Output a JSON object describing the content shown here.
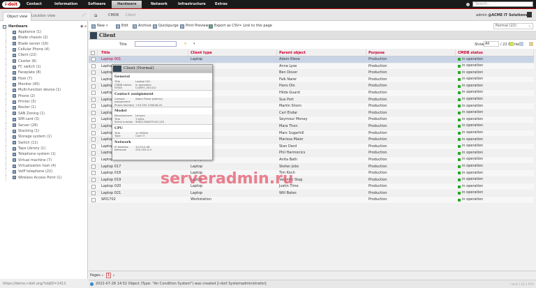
{
  "brand": {
    "logo": "i-doit",
    "accent": "#cc0000"
  },
  "nav": [
    "Contact",
    "Information",
    "Software",
    "Hardware",
    "Network",
    "Infrastructure",
    "Extras"
  ],
  "nav_active": "Hardware",
  "search": {
    "placeholder": "Search..."
  },
  "user": {
    "name": "admin",
    "tenant": "@ACME IT Solutions"
  },
  "sidebar": {
    "tabs": [
      "Object view",
      "Location view"
    ],
    "root": "Hardware",
    "items": [
      "Appliance (1)",
      "Blade chassis (2)",
      "Blade server (16)",
      "Cellular Phone (4)",
      "Client (22)",
      "Cluster (6)",
      "FC switch (1)",
      "Faceplate (8)",
      "Host (7)",
      "Monitor (45)",
      "Multi-function device (1)",
      "Phone (2)",
      "Printer (3)",
      "Router (1)",
      "SAN Zoning (1)",
      "SIM card (3)",
      "Server (26)",
      "Stacking (1)",
      "Storage system (1)",
      "Switch (11)",
      "Tape Library (1)",
      "Telephone system (1)",
      "Virtual machine (7)",
      "Virtualization host (4)",
      "VoIP telephone (22)",
      "Wireless Access Point (1)"
    ]
  },
  "breadcrumb": [
    "CMDB",
    "Client"
  ],
  "toolbar": {
    "new": "New",
    "edit": "Edit",
    "archive": "Archive",
    "quickpurge": "Quickpurge",
    "print": "Print Preview",
    "export": "Export as CSV",
    "link": "Link to this page"
  },
  "view_select": "Normal (22)",
  "page_title": "Client",
  "filter": {
    "label": "Title",
    "value": ""
  },
  "list_info": {
    "show_label": "Show",
    "show_value": "All",
    "entries": "/ 22 Entries"
  },
  "table": {
    "columns": [
      "Title",
      "Client type",
      "Parent object",
      "Purpose",
      "CMDB status"
    ],
    "rows": [
      [
        "Laptop 001",
        "Laptop",
        "Adam Riese",
        "Production",
        "in operation"
      ],
      [
        "Laptop 002",
        "Laptop",
        "Anna Lyse",
        "Production",
        "in operation"
      ],
      [
        "Laptop 003",
        "Laptop",
        "Ben Dover",
        "Production",
        "in operation"
      ],
      [
        "Laptop 004",
        "Laptop",
        "Falk Narer",
        "Production",
        "in operation"
      ],
      [
        "Laptop 005",
        "Laptop",
        "Hans Olo",
        "Production",
        "in operation"
      ],
      [
        "Laptop 006",
        "Laptop",
        "Hilde Guard",
        "Production",
        "in operation"
      ],
      [
        "Laptop 007",
        "Laptop",
        "Sue Port",
        "Production",
        "in operation"
      ],
      [
        "Laptop 008",
        "Laptop",
        "Martin Shorn",
        "Production",
        "in operation"
      ],
      [
        "Laptop 009",
        "Laptop",
        "Carl Endar",
        "Production",
        "in operation"
      ],
      [
        "Laptop 010",
        "Laptop",
        "Seymour Money",
        "Production",
        "in operation"
      ],
      [
        "Laptop 011",
        "Laptop",
        "Mara Thon",
        "Production",
        "in operation"
      ],
      [
        "Laptop 012",
        "Laptop",
        "Marc Sugarhill",
        "Production",
        "in operation"
      ],
      [
        "Laptop 013",
        "Laptop",
        "Marissa Maier",
        "Production",
        "in operation"
      ],
      [
        "Laptop 014",
        "Laptop",
        "Stan Dard",
        "Production",
        "in operation"
      ],
      [
        "Laptop 015",
        "Laptop",
        "Phil Harmonics",
        "Production",
        "in operation"
      ],
      [
        "Laptop 016",
        "Laptop",
        "Anita Bath",
        "Production",
        "in operation"
      ],
      [
        "Laptop 017",
        "Laptop",
        "Stefan Jobs",
        "Production",
        "in operation"
      ],
      [
        "Laptop 018",
        "Laptop",
        "Tim Koch",
        "Production",
        "in operation"
      ],
      [
        "Laptop 019",
        "Laptop",
        "Valentin Stag",
        "Production",
        "in operation"
      ],
      [
        "Laptop 020",
        "Laptop",
        "Justin Time",
        "Production",
        "in operation"
      ],
      [
        "Laptop 021",
        "Laptop",
        "Will Bates",
        "Production",
        "in operation"
      ],
      [
        "W01702",
        "Workstation",
        "",
        "Production",
        "in operation"
      ]
    ],
    "status_color": "#22aa22"
  },
  "popup": {
    "title": "Client (Normal)",
    "sections": [
      {
        "name": "General",
        "rows": [
          [
            "Title",
            "Laptop 001"
          ],
          [
            "CMDB status",
            "in operation"
          ],
          [
            "SYSID",
            "CLIENT_001412"
          ]
        ]
      },
      {
        "name": "Contact assignment",
        "rows": [
          [
            "Contact assignment",
            "Adam Riese [admin]"
          ],
          [
            "Phone Number",
            "+49 555 226048-20"
          ]
        ]
      },
      {
        "name": "Model",
        "rows": [
          [
            "Manufacturer",
            "Lenovo"
          ],
          [
            "Title",
            "T-450s"
          ],
          [
            "Serial number",
            "9082136487543112S"
          ]
        ]
      },
      {
        "name": "CPU",
        "rows": [
          [
            "Title",
            "1x 5600U"
          ],
          [
            "Type",
            "Core i7"
          ]
        ]
      },
      {
        "name": "Network",
        "rows": [
          [
            "IP Address",
            "10.20.0.46"
          ],
          [
            "Netmask",
            "255.255.0.0"
          ]
        ]
      }
    ]
  },
  "pager": {
    "label": "Pages",
    "current": "1"
  },
  "status_message": "2022-07-28 14:52 Object (Type: \"Air Condition System\") was created [i-doit Systemadministrator]",
  "url": "https://demo.i-doit.org/?objID=1412",
  "version": "i-doit 1.18.2 PRO",
  "watermark": "serveradmin.ru"
}
